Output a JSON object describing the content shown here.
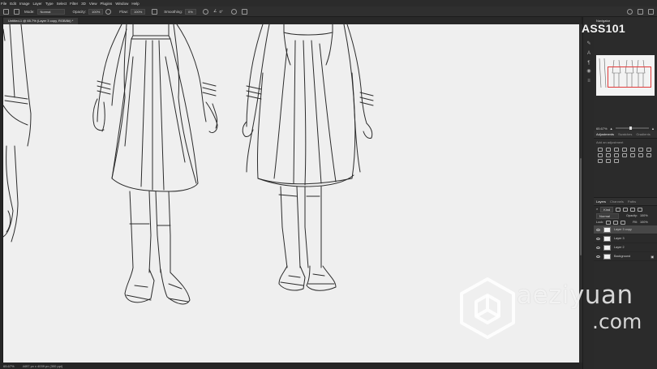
{
  "menubar": {
    "items": [
      "File",
      "Edit",
      "Image",
      "Layer",
      "Type",
      "Select",
      "Filter",
      "3D",
      "View",
      "Plugins",
      "Window",
      "Help"
    ]
  },
  "options": {
    "mode_label": "Mode:",
    "mode_value": "Normal",
    "opacity_label": "Opacity:",
    "opacity_value": "100%",
    "flow_label": "Flow:",
    "flow_value": "100%",
    "smoothing_label": "Smoothing:",
    "smoothing_value": "0%",
    "angle_value": "0°"
  },
  "document": {
    "tab_title": "Untitled-1 @ 65.7% (Layer 3 copy, RGB/8#) *"
  },
  "status": {
    "zoom": "65.67%",
    "doc_size": "4497 px x 4039 px (300 ppi)"
  },
  "brand_overlay": "ASS101",
  "navigator": {
    "title": "Navigator",
    "zoom": "65.67%"
  },
  "adjustments": {
    "tabs": [
      "Adjustments",
      "Swatches",
      "Gradients"
    ],
    "active_tab": "Adjustments",
    "hint": "Add an adjustment"
  },
  "layers_panel": {
    "tabs": [
      "Layers",
      "Channels",
      "Paths"
    ],
    "active_tab": "Layers",
    "filter_label": "Kind",
    "blend_mode": "Normal",
    "opacity_label": "Opacity:",
    "opacity_value": "100%",
    "lock_label": "Lock:",
    "fill_label": "Fill:",
    "fill_value": "100%",
    "layers": [
      {
        "name": "Layer 3 copy",
        "selected": true
      },
      {
        "name": "Layer 3",
        "selected": false
      },
      {
        "name": "Layer 2",
        "selected": false
      },
      {
        "name": "Background",
        "selected": false
      }
    ]
  },
  "watermark": {
    "text": "aeziyuan",
    "domain": ".com"
  }
}
